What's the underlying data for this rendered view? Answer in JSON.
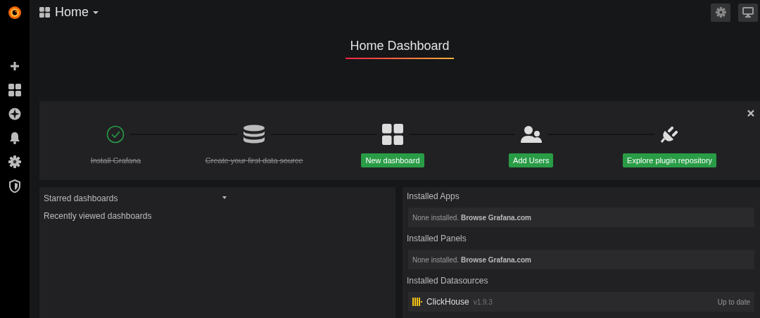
{
  "header": {
    "title": "Home"
  },
  "dashboard_title": "Home Dashboard",
  "getting_started": {
    "steps": [
      {
        "label": "Install Grafana",
        "done": true
      },
      {
        "label": "Create your first data source",
        "done": true
      },
      {
        "label": "New dashboard",
        "done": false
      },
      {
        "label": "Add Users",
        "done": false
      },
      {
        "label": "Explore plugin repository",
        "done": false
      }
    ]
  },
  "dashboard_list": {
    "sections": [
      {
        "title": "Starred dashboards",
        "expanded": true
      },
      {
        "title": "Recently viewed dashboards",
        "expanded": false
      }
    ]
  },
  "plugins": {
    "sections": [
      {
        "title": "Installed Apps",
        "items": [
          {
            "kind": "empty",
            "text": "None installed. **Browse Grafana.com**"
          }
        ]
      },
      {
        "title": "Installed Panels",
        "items": [
          {
            "kind": "empty",
            "text": "None installed. **Browse Grafana.com**"
          }
        ]
      },
      {
        "title": "Installed Datasources",
        "items": [
          {
            "kind": "datasource",
            "name": "ClickHouse",
            "version": "v1.9.3",
            "status": "Up to date"
          }
        ]
      }
    ]
  }
}
